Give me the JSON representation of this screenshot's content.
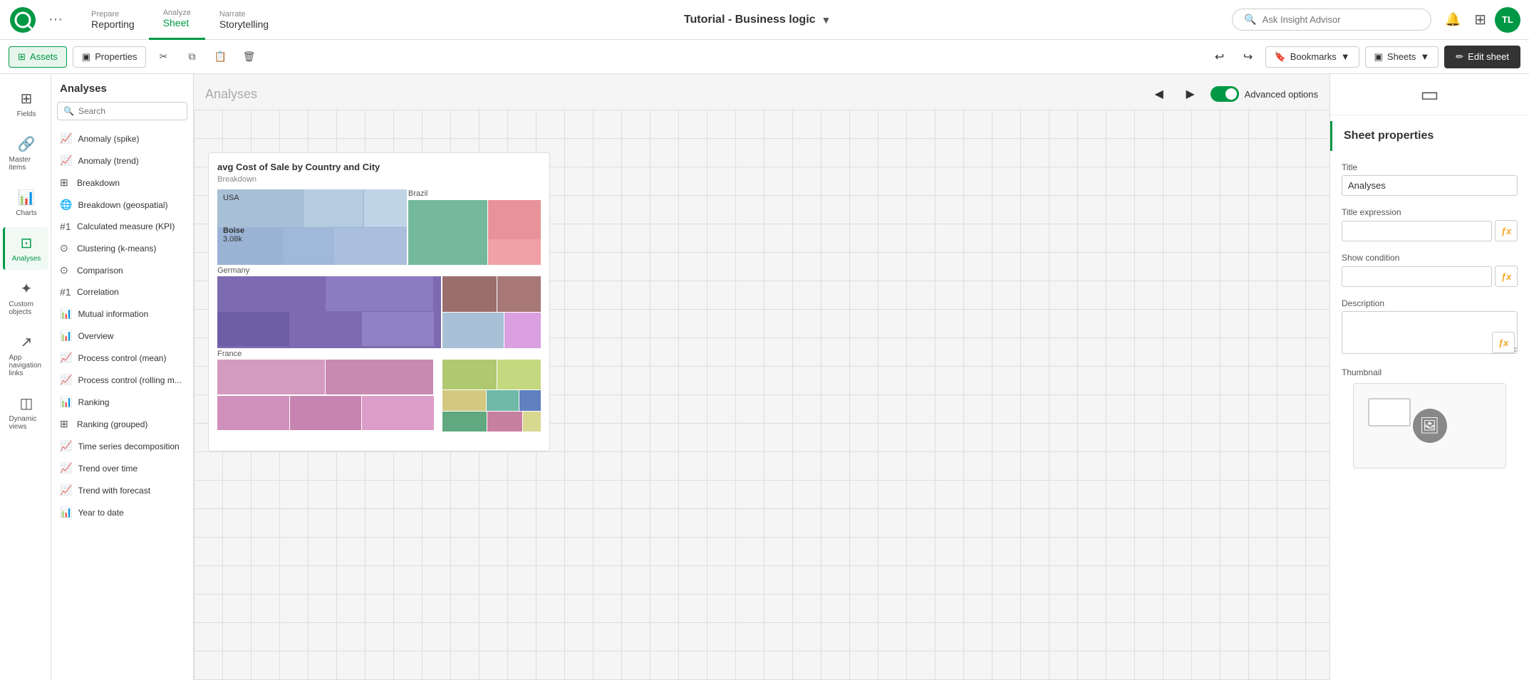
{
  "topNav": {
    "prepare_label": "Prepare",
    "prepare_sub": "Reporting",
    "analyze_label": "Analyze",
    "analyze_sub": "Sheet",
    "narrate_label": "Narrate",
    "narrate_sub": "Storytelling",
    "app_title": "Tutorial - Business logic",
    "search_placeholder": "Ask Insight Advisor",
    "user_initials": "TL"
  },
  "toolbar": {
    "assets_label": "Assets",
    "properties_label": "Properties",
    "bookmarks_label": "Bookmarks",
    "sheets_label": "Sheets",
    "edit_sheet_label": "Edit sheet"
  },
  "sidebar": {
    "items": [
      {
        "id": "fields",
        "label": "Fields",
        "icon": "⊞"
      },
      {
        "id": "master-items",
        "label": "Master items",
        "icon": "🔗"
      },
      {
        "id": "charts",
        "label": "Charts",
        "icon": "📊"
      },
      {
        "id": "analyses",
        "label": "Analyses",
        "icon": "⊡",
        "active": true
      },
      {
        "id": "custom-objects",
        "label": "Custom objects",
        "icon": "✦"
      },
      {
        "id": "app-nav",
        "label": "App navigation links",
        "icon": "↗"
      },
      {
        "id": "dynamic-views",
        "label": "Dynamic views",
        "icon": "◫"
      }
    ]
  },
  "analysesPanel": {
    "title": "Analyses",
    "search_placeholder": "Search",
    "items": [
      {
        "label": "Anomaly (spike)",
        "icon": "📈"
      },
      {
        "label": "Anomaly (trend)",
        "icon": "📈"
      },
      {
        "label": "Breakdown",
        "icon": "⊞"
      },
      {
        "label": "Breakdown (geospatial)",
        "icon": "🌐"
      },
      {
        "label": "Calculated measure (KPI)",
        "icon": "#1"
      },
      {
        "label": "Clustering (k-means)",
        "icon": "⊙"
      },
      {
        "label": "Comparison",
        "icon": "⊙"
      },
      {
        "label": "Correlation",
        "icon": "#1"
      },
      {
        "label": "Mutual information",
        "icon": "📊"
      },
      {
        "label": "Overview",
        "icon": "📊"
      },
      {
        "label": "Process control (mean)",
        "icon": "📈"
      },
      {
        "label": "Process control (rolling m...",
        "icon": "📈"
      },
      {
        "label": "Ranking",
        "icon": "📊"
      },
      {
        "label": "Ranking (grouped)",
        "icon": "⊞"
      },
      {
        "label": "Time series decomposition",
        "icon": "📈"
      },
      {
        "label": "Trend over time",
        "icon": "📈"
      },
      {
        "label": "Trend with forecast",
        "icon": "📈"
      },
      {
        "label": "Year to date",
        "icon": "📊"
      }
    ]
  },
  "canvas": {
    "title": "Analyses",
    "advanced_options_label": "Advanced options",
    "chart": {
      "title": "avg Cost of Sale by Country and City",
      "subtitle": "Breakdown",
      "countries": [
        "USA",
        "Brazil",
        "Germany",
        "France"
      ],
      "boise_label": "Boise",
      "boise_value": "3.08k"
    }
  },
  "propertiesPanel": {
    "section_title": "Sheet properties",
    "title_label": "Title",
    "title_value": "Analyses",
    "title_expr_label": "Title expression",
    "show_condition_label": "Show condition",
    "description_label": "Description",
    "thumbnail_label": "Thumbnail"
  }
}
